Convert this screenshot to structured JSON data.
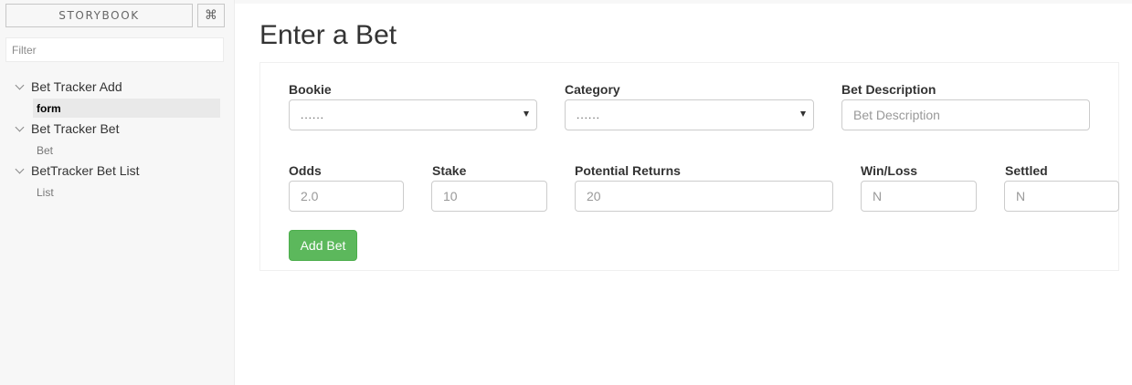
{
  "sidebar": {
    "brand": "STORYBOOK",
    "shortcut_icon": "⌘",
    "filter_placeholder": "Filter",
    "kinds": [
      {
        "name": "Bet Tracker Add",
        "stories": [
          "form"
        ]
      },
      {
        "name": "Bet Tracker Bet",
        "stories": [
          "Bet"
        ]
      },
      {
        "name": "BetTracker Bet List",
        "stories": [
          "List"
        ]
      }
    ],
    "active_story": "form"
  },
  "main": {
    "title": "Enter a Bet",
    "form": {
      "bookie": {
        "label": "Bookie",
        "value": "......"
      },
      "category": {
        "label": "Category",
        "value": "......"
      },
      "description": {
        "label": "Bet Description",
        "placeholder": "Bet Description"
      },
      "odds": {
        "label": "Odds",
        "placeholder": "2.0"
      },
      "stake": {
        "label": "Stake",
        "placeholder": "10"
      },
      "returns": {
        "label": "Potential Returns",
        "placeholder": "20"
      },
      "winloss": {
        "label": "Win/Loss",
        "placeholder": "N"
      },
      "settled": {
        "label": "Settled",
        "placeholder": "N"
      },
      "submit_label": "Add Bet"
    }
  },
  "colors": {
    "success_button": "#5cb85c",
    "sidebar_bg": "#f7f7f7",
    "active_story_bg": "#e9e9e9"
  }
}
